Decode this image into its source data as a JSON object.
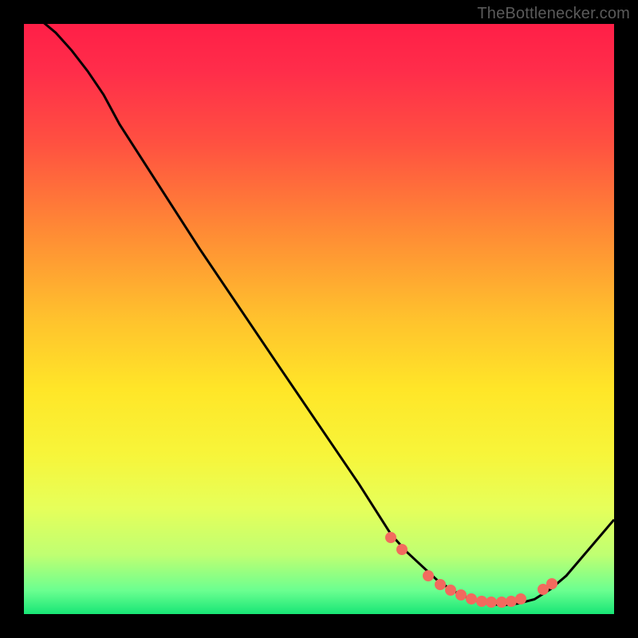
{
  "attribution": "TheBottlenecker.com",
  "chart_data": {
    "type": "line",
    "title": "",
    "xlabel": "",
    "ylabel": "",
    "xlim": [
      0,
      100
    ],
    "ylim": [
      0,
      100
    ],
    "x": [
      0,
      5.4,
      8.1,
      10.8,
      13.5,
      16.2,
      29.7,
      43.2,
      56.8,
      62.2,
      64.9,
      67.6,
      70.3,
      73.0,
      75.7,
      78.4,
      81.1,
      83.8,
      86.5,
      89.2,
      91.9,
      100.0
    ],
    "values": [
      103,
      98.5,
      95.5,
      92.0,
      88.0,
      83.0,
      62.0,
      42.0,
      22.0,
      13.5,
      10.5,
      8.0,
      5.5,
      3.8,
      2.5,
      1.8,
      1.5,
      1.8,
      2.5,
      4.2,
      6.5,
      16.0
    ],
    "markers": {
      "x": [
        62.2,
        64.0,
        68.5,
        70.5,
        72.3,
        74.0,
        75.8,
        77.5,
        79.2,
        81.0,
        82.6,
        84.2,
        88.0,
        89.5
      ],
      "values": [
        13.0,
        11.0,
        6.5,
        5.0,
        4.0,
        3.2,
        2.6,
        2.2,
        2.0,
        2.0,
        2.2,
        2.6,
        4.2,
        5.2
      ]
    },
    "colors": {
      "curve": "#000000",
      "marker": "#f26a5e"
    }
  }
}
